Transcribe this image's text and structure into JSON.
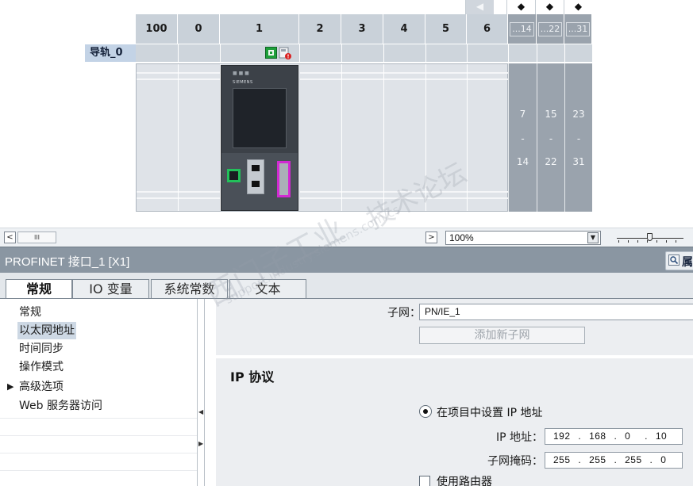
{
  "device_view": {
    "slot_headers": [
      "100",
      "0",
      "1",
      "2",
      "3",
      "4",
      "5",
      "6",
      "...14",
      "...22",
      "...31"
    ],
    "rail_label": "导轨_0",
    "ext_ranges": [
      {
        "start": "7",
        "dash": "-",
        "end": "14"
      },
      {
        "start": "15",
        "dash": "-",
        "end": "22"
      },
      {
        "start": "23",
        "dash": "-",
        "end": "31"
      }
    ],
    "cpu_brand": "SIEMENS",
    "cpu_leds": "■ ■ ■"
  },
  "view_toolbar": {
    "scroll_left": "<",
    "scroll_thumb": "III",
    "scroll_right": ">",
    "zoom_value": "100%",
    "zoom_dropdown_icon": "▼"
  },
  "inspector": {
    "title": "PROFINET 接口_1 [X1]",
    "properties_tab_partial": "属",
    "tabs": [
      "常规",
      "IO 变量",
      "系统常数",
      "文本"
    ],
    "nav_items": [
      "常规",
      "以太网地址",
      "时间同步",
      "操作模式",
      "高级选项",
      "Web 服务器访问"
    ],
    "nav_selected": "以太网地址",
    "expand_caret": "▶"
  },
  "ethernet": {
    "subnet_label": "子网：",
    "subnet_value": "PN/IE_1",
    "add_subnet_button": "添加新子网",
    "ip_protocol_title": "IP 协议",
    "set_in_project_label": "在项目中设置 IP 地址",
    "ip_label": "IP 地址：",
    "ip_parts": [
      "192",
      ".",
      "168",
      ".",
      "0",
      ".",
      "10"
    ],
    "mask_label": "子网掩码：",
    "mask_parts": [
      "255",
      ".",
      "255",
      ".",
      "255",
      ".",
      "0"
    ],
    "use_router_label": "使用路由器"
  },
  "watermark": {
    "line1": "西门子工业",
    "line2": "技术论坛",
    "line3": "support.industry.siemens.com/cs"
  },
  "colors": {
    "header_gray": "#c9d1d9",
    "inspector_title": "#8a96a2",
    "selected_nav": "#cdd8e4",
    "port_green": "#22c05a",
    "port_magenta": "#d22ad2"
  }
}
